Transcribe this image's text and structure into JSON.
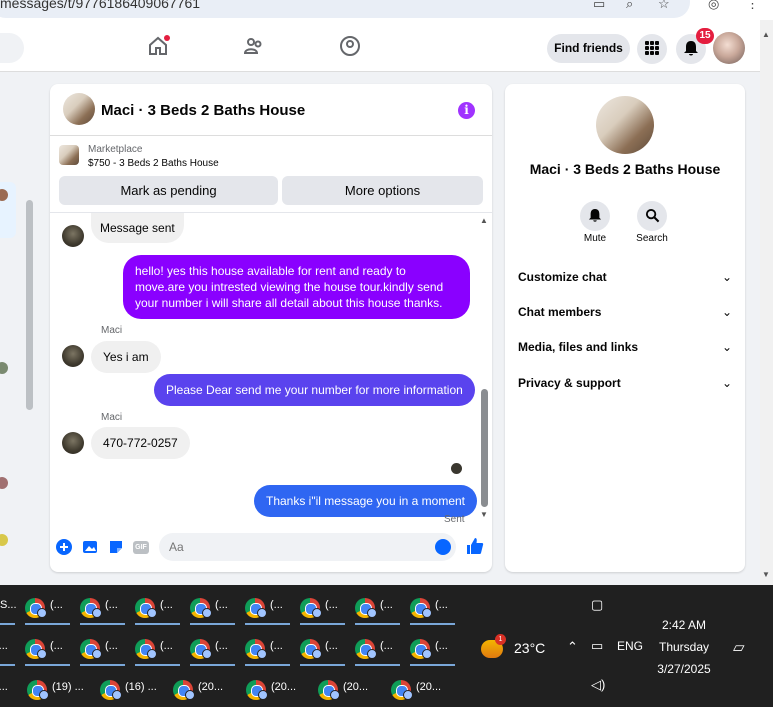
{
  "browser": {
    "url": "messages/t/9776186409067761"
  },
  "topnav": {
    "find_friends": "Find friends",
    "notif_count": "15"
  },
  "chat": {
    "title": "Maci · 3 Beds 2 Baths House",
    "marketplace_label": "Marketplace",
    "marketplace_listing": "$750 - 3 Beds 2 Baths House",
    "mark_pending": "Mark as pending",
    "more_options": "More options",
    "messages": [
      {
        "from": "other",
        "text": "Message sent"
      },
      {
        "from": "me",
        "text": "hello! yes this house available for rent and ready to move.are you intrested viewing the house tour.kindly send your number i will share all detail about this house thanks."
      },
      {
        "from": "other",
        "sender": "Maci",
        "text": "Yes i am"
      },
      {
        "from": "me",
        "text": "Please Dear send me your number for more information"
      },
      {
        "from": "other",
        "sender": "Maci",
        "text": "470-772-0257"
      },
      {
        "from": "me",
        "text": "Thanks i\"il message you in a moment"
      }
    ],
    "sent_status": "Sent",
    "input_placeholder": "Aa",
    "gif_label": "GIF"
  },
  "profile": {
    "title": "Maci · 3 Beds 2 Baths House",
    "mute": "Mute",
    "search": "Search",
    "sections": [
      "Customize chat",
      "Chat members",
      "Media, files and links",
      "Privacy & support"
    ]
  },
  "taskbar": {
    "rows": [
      [
        "S...",
        "(...",
        "(...",
        "(...",
        "(...",
        "(...",
        "(...",
        "(...",
        "(..."
      ],
      [
        "(...",
        "(...",
        "(...",
        "(...",
        "(...",
        "(...",
        "(...",
        "(...",
        "(..."
      ],
      [
        "(...",
        "(19) ...",
        "(16) ...",
        "(20...",
        "(20...",
        "(20...",
        "(20..."
      ]
    ],
    "weather_badge": "1",
    "temperature": "23°C",
    "language": "ENG",
    "time": "2:42 AM",
    "day": "Thursday",
    "date": "3/27/2025"
  },
  "colors": {
    "accent": "#0866ff",
    "sent_purple": "#8a00ff",
    "sent_indigo": "#5a43ee",
    "sent_blue": "#2f66f2"
  }
}
